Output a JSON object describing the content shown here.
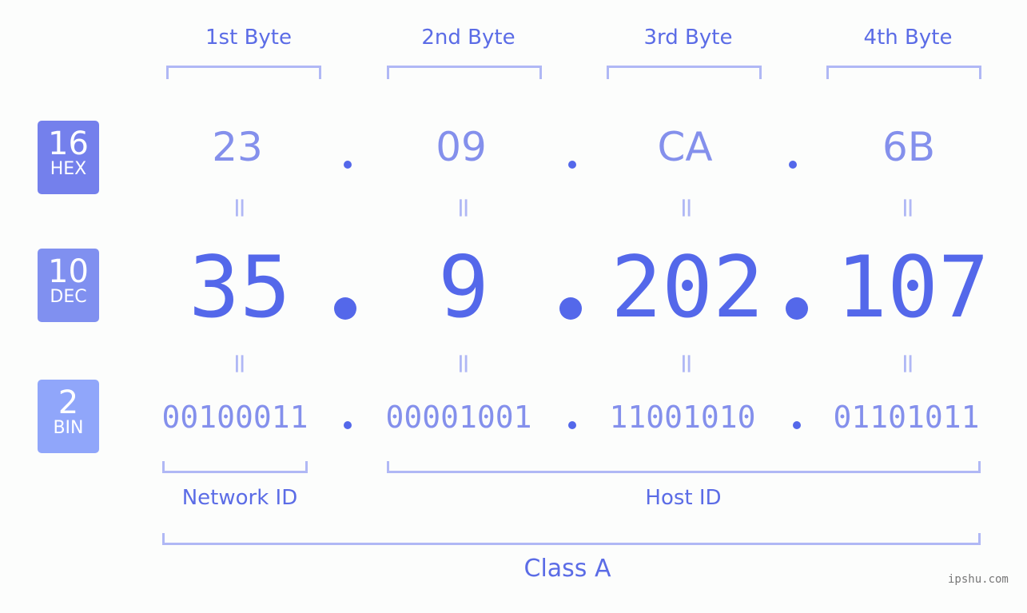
{
  "bytes": [
    {
      "label": "1st Byte",
      "hex": "23",
      "dec": "35",
      "bin": "00100011"
    },
    {
      "label": "2nd Byte",
      "hex": "09",
      "dec": "9",
      "bin": "00001001"
    },
    {
      "label": "3rd Byte",
      "hex": "CA",
      "dec": "202",
      "bin": "11001010"
    },
    {
      "label": "4th Byte",
      "hex": "6B",
      "dec": "107",
      "bin": "01101011"
    }
  ],
  "badges": {
    "hex": {
      "base": "16",
      "name": "HEX",
      "color": "#7480ec"
    },
    "dec": {
      "base": "10",
      "name": "DEC",
      "color": "#8090f0"
    },
    "bin": {
      "base": "2",
      "name": "BIN",
      "color": "#90a6fa"
    }
  },
  "equals_glyph": "=",
  "sections": {
    "network": "Network ID",
    "host": "Host ID",
    "class": "Class A"
  },
  "watermark": "ipshu.com",
  "colors": {
    "accent": "#5468ea",
    "light": "#8490ec",
    "bracket": "#b0b8f5"
  }
}
